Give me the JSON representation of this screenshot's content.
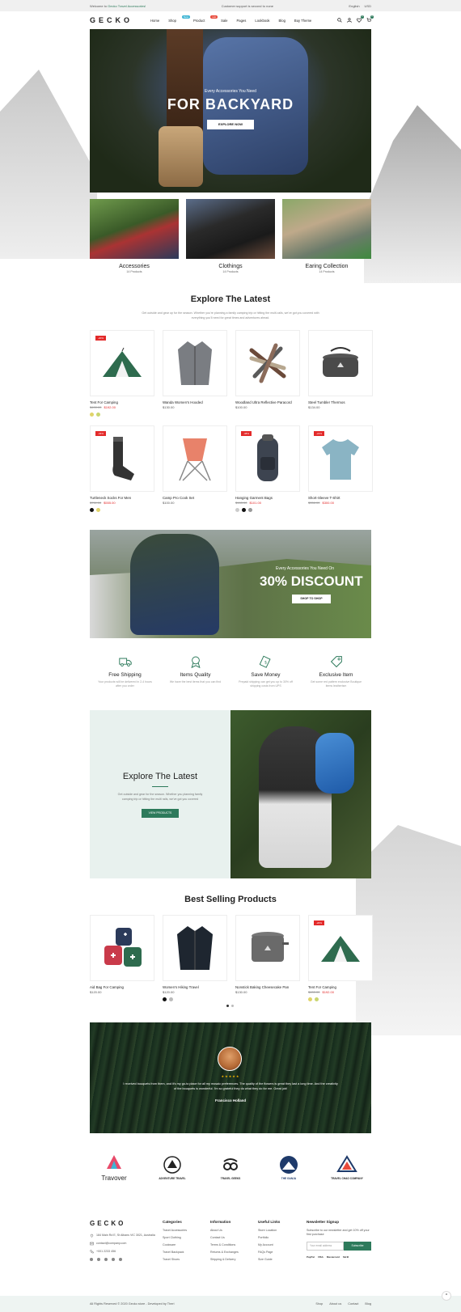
{
  "topbar": {
    "welcome_prefix": "Welcome to",
    "welcome_brand": "Gecko Travel Accessories!",
    "support": "Customer support is second to none",
    "language": "English",
    "currency": "USD"
  },
  "header": {
    "logo": "GECKO",
    "nav": [
      {
        "label": "Home",
        "badge": ""
      },
      {
        "label": "Shop",
        "badge": "New"
      },
      {
        "label": "Product",
        "badge": "Hot"
      },
      {
        "label": "Sale",
        "badge": ""
      },
      {
        "label": "Pages",
        "badge": ""
      },
      {
        "label": "Lookbook",
        "badge": ""
      },
      {
        "label": "Blog",
        "badge": ""
      },
      {
        "label": "Buy Theme",
        "badge": ""
      }
    ],
    "wishlist_count": "0",
    "cart_count": "0"
  },
  "hero": {
    "subtitle": "Every Accessories You Need",
    "title": "FOR BACKYARD",
    "button": "EXPLORE NOW"
  },
  "categories": [
    {
      "name": "Accessories",
      "count": "14 Products"
    },
    {
      "name": "Clothings",
      "count": "14 Products"
    },
    {
      "name": "Earing Collection",
      "count": "14 Products"
    }
  ],
  "latest": {
    "title": "Explore The Latest",
    "description": "Get outside and gear up for the season. Whether you're planning a family camping trip or hitting the multi-rails, we've got you covered with everything you'll need for great times and adventures ahead."
  },
  "products_row1": [
    {
      "name": "Tent For Camping",
      "old_price": "$400.00",
      "price": "$192.00",
      "sale": "-20%",
      "swatches": [
        "#e0d46a",
        "#c9d670"
      ]
    },
    {
      "name": "Wanda Women's Hooded",
      "old_price": "",
      "price": "$130.00",
      "sale": "",
      "swatches": []
    },
    {
      "name": "Woodland Ultra Reflective Paracord",
      "old_price": "",
      "price": "$100.00",
      "sale": "",
      "swatches": []
    },
    {
      "name": "Steel Tumbler Thermos",
      "old_price": "",
      "price": "$134.00",
      "sale": "",
      "swatches": []
    }
  ],
  "products_row2": [
    {
      "name": "Turtleneck Socks For Men",
      "old_price": "$711.00",
      "price": "$555.00",
      "sale": "-34%",
      "swatches": [
        "#111111",
        "#e0d46a"
      ]
    },
    {
      "name": "Camp Pro Cook Set",
      "old_price": "",
      "price": "$100.00",
      "sale": "",
      "swatches": []
    },
    {
      "name": "Hanging Garment Bags",
      "old_price": "$163.00",
      "price": "$101.00",
      "sale": "-38%",
      "swatches": [
        "#cccccc",
        "#111111",
        "#999999"
      ]
    },
    {
      "name": "Short-Sleeve T-Shirt",
      "old_price": "$356.00",
      "price": "$300.00",
      "sale": "-21%",
      "swatches": []
    }
  ],
  "discount": {
    "subtitle": "Every Accessories You Need On",
    "title": "30% DISCOUNT",
    "button": "SHOP TO SHOP"
  },
  "features": [
    {
      "title": "Free Shipping",
      "desc": "Your products will be delivered in 2-4 hours after you order"
    },
    {
      "title": "Items Quality",
      "desc": "We have the best items that you can find"
    },
    {
      "title": "Save Money",
      "desc": "Prepaid shipping can get you up to 30% off shipping costs from UPS"
    },
    {
      "title": "Exclusive Item",
      "desc": "Get some red pattern exclusive Boutique items leatherism"
    }
  ],
  "explore_banner": {
    "title": "Explore The Latest",
    "desc": "Get outside and gear for the season. Whether you planning family camping trip or hitting the multi rails, we've got you covered",
    "button": "VIEW PRODUCTS"
  },
  "best_selling": {
    "title": "Best Selling Products",
    "items": [
      {
        "name": "Aid Bag For Camping",
        "price": "$120.00",
        "sale": "",
        "swatches": []
      },
      {
        "name": "Women's Hiking Travel",
        "price": "$120.00",
        "sale": "",
        "swatches": [
          "#111111",
          "#bbbbbb"
        ]
      },
      {
        "name": "Nonstick Baking Cheesecake Pan",
        "price": "$130.00",
        "sale": "",
        "swatches": []
      },
      {
        "name": "Tent For Camping",
        "old_price": "$400.00",
        "price": "$192.00",
        "sale": "-20%",
        "swatches": [
          "#e0d46a",
          "#c9d670"
        ]
      }
    ]
  },
  "testimonial": {
    "stars": "★★★★★",
    "quote": "I received bouquets from them, and it's my go-to place for all my mosaic preferences. The quality of the flowers is great they last a long time. And the creativity of the bouquets is wonderful. I'm so grateful they do what they do for me. Great job!",
    "author": "Francisco Holland"
  },
  "brands": [
    "Travover",
    "ADVENTURE TRAVEL",
    "TRAVEL GEEKS",
    "THE GANJA",
    "TRAVEL CHAO COMPANY"
  ],
  "footer": {
    "logo": "GECKO",
    "address": "184 Main Rd E, St Albans VIC 3021, Australia",
    "email": "contact@company.com",
    "phone": "+001 2233 456",
    "columns": [
      {
        "title": "Categories",
        "links": [
          "Travel Accessories",
          "Sport Clothing",
          "Cookware",
          "Travel Backpack",
          "Travel Shoes"
        ]
      },
      {
        "title": "Information",
        "links": [
          "About Us",
          "Contact Us",
          "Terms & Conditions",
          "Returns & Exchanges",
          "Shipping & Delivery"
        ]
      },
      {
        "title": "Useful Links",
        "links": [
          "Store Location",
          "Portfolio",
          "My Account",
          "FAQs Page",
          "Size Guide"
        ]
      }
    ],
    "newsletter_title": "Newsletter Signup",
    "newsletter_desc": "Subscribe to our newsletter and get 10% off your first purchase",
    "newsletter_placeholder": "Your email address",
    "newsletter_button": "Subscribe",
    "payments": [
      "PayPal",
      "VISA",
      "Mastercard",
      "Skrill"
    ]
  },
  "bottombar": {
    "copyright": "All Rights Reserved © 2020 Gecko store - Developed by Theri",
    "links": [
      "Shop",
      "About us",
      "Contact",
      "Blog"
    ]
  },
  "colors": {
    "accent": "#2d7a5b",
    "sale": "#e32a2a",
    "new_badge": "#3fb5d4",
    "hot_badge": "#e84a3c"
  }
}
